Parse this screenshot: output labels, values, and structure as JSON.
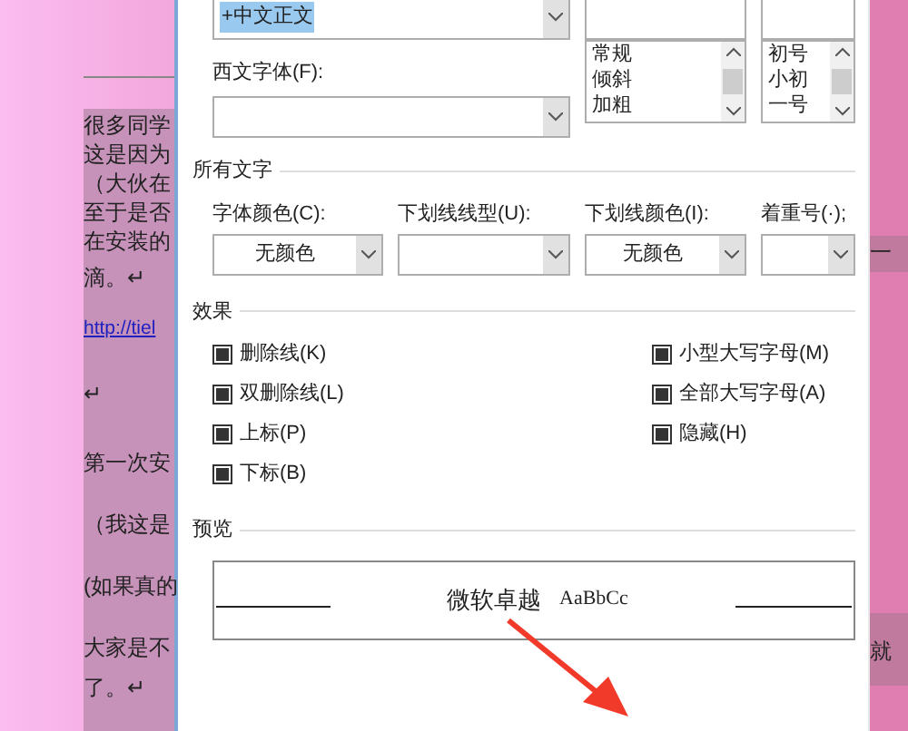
{
  "document": {
    "lines": [
      {
        "kind": "text",
        "text": "很多同学"
      },
      {
        "kind": "text",
        "text": "这是因为"
      },
      {
        "kind": "text",
        "text": "（大伙在"
      },
      {
        "kind": "text",
        "text": "至于是否"
      },
      {
        "kind": "text",
        "text": "在安装的"
      },
      {
        "kind": "text",
        "text": "滴。↵"
      },
      {
        "kind": "link",
        "text": "http://tiel"
      },
      {
        "kind": "text",
        "text": "↵"
      },
      {
        "kind": "text",
        "text": "第一次安"
      },
      {
        "kind": "text",
        "text": "（我这是"
      },
      {
        "kind": "text",
        "text": "(如果真的"
      },
      {
        "kind": "text",
        "text": "大家是不"
      },
      {
        "kind": "text",
        "text": "了。↵"
      }
    ],
    "right_fragments": [
      "一",
      "就"
    ]
  },
  "dialog": {
    "chinese_font": {
      "value": "+中文正文"
    },
    "style_list": {
      "items": [
        "常规",
        "倾斜",
        "加粗"
      ]
    },
    "size_list": {
      "items": [
        "初号",
        "小初",
        "一号"
      ]
    },
    "western_font": {
      "label": "西文字体(F):"
    },
    "all_text": {
      "title": "所有文字",
      "fields": [
        {
          "label": "字体颜色(C):",
          "value": "无颜色"
        },
        {
          "label": "下划线线型(U):"
        },
        {
          "label": "下划线颜色(I):",
          "value": "无颜色"
        },
        {
          "label": "着重号(·);"
        }
      ]
    },
    "effects": {
      "title": "效果",
      "left": [
        {
          "label": "删除线(K)",
          "indeterminate": true
        },
        {
          "label": "双删除线(L)",
          "indeterminate": true
        },
        {
          "label": "上标(P)",
          "indeterminate": true
        },
        {
          "label": "下标(B)",
          "indeterminate": true
        }
      ],
      "right": [
        {
          "label": "小型大写字母(M)",
          "indeterminate": true
        },
        {
          "label": "全部大写字母(A)",
          "indeterminate": true
        },
        {
          "label": "隐藏(H)",
          "indeterminate": true
        }
      ]
    },
    "preview": {
      "title": "预览",
      "sample": "微软卓越",
      "sample_latin": "AaBbCc"
    }
  }
}
